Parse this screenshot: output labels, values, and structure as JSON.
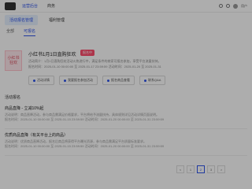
{
  "nav": {
    "items": [
      "运营后台",
      "商务"
    ],
    "user": "用户"
  },
  "tabs": [
    {
      "label": "活动报名管理",
      "active": true
    },
    {
      "label": "福利管理",
      "active": false
    }
  ],
  "subtabs": [
    {
      "label": "全部",
      "active": false
    },
    {
      "label": "可报名",
      "active": true
    }
  ],
  "card": {
    "thumb_text": "小红书\n狂欢",
    "title": "小红书1月1日直购狂欢",
    "badge": "报名中",
    "desc": "活动简介：1月1日直购狂欢活动火热进行中，满足条件的商家可报名参加，享受平台流量扶持。",
    "time": "报名时间：2025-01-10 00:00:00 至 2025-01-17 23:59:59  活动时间：2025-01-20 至 2025-01-31",
    "buttons": [
      "活动详情",
      "我要报名参加活动",
      "报名商品查看",
      "联系Q&A"
    ]
  },
  "section_title": "活动报名",
  "items": [
    {
      "title": "商品直降 - 立减10%起",
      "line1": "活动说明：商品直降活动，参与商品需满足价格要求，平台将给予流量扶持，具体规则详见活动详情页面说明。",
      "line2": "报名时间：2025-01-10 00:00:00 至 2025-01-15 23:59:59  活动时间：2025-01-20 00:00:00 至 2025-01-31 23:59:59"
    },
    {
      "title": "优质商品直降（有关平台上的商品）",
      "line1": "活动说明：优质商品直降活动，报名后商品将获得平台曝光资源，参与商品需满足平台质量标准要求。",
      "line2": "报名时间：2025-01-10 00:00:00 至 2025-01-15 23:59:59  活动时间：2025-01-20 00:00:00 至 2025-01-31 23:59:59"
    }
  ],
  "pagination": {
    "pages": [
      "<",
      "1",
      "2",
      "3",
      ">"
    ],
    "current": "2"
  }
}
